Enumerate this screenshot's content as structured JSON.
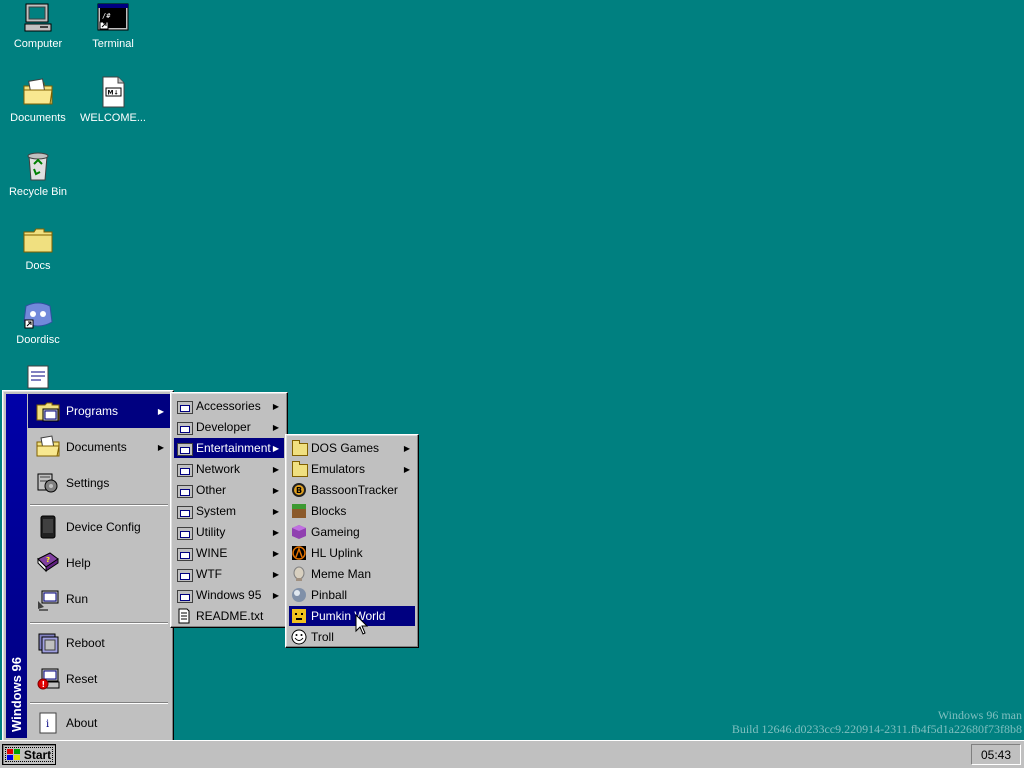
{
  "desktop": {
    "icons": [
      {
        "label": "Computer",
        "icon": "computer-icon"
      },
      {
        "label": "Terminal",
        "icon": "terminal-icon"
      },
      {
        "label": "Documents",
        "icon": "documents-folder-icon"
      },
      {
        "label": "WELCOME...",
        "icon": "markdown-file-icon"
      },
      {
        "label": "Recycle Bin",
        "icon": "recycle-bin-icon"
      },
      {
        "label": "Docs",
        "icon": "folder-icon"
      },
      {
        "label": "Doordisc",
        "icon": "doordisc-icon"
      }
    ],
    "watermark": {
      "line1": "Windows 96 man",
      "line2": "Build 12646.d0233cc9.220914-2311.fb4f5d1a22680f73f8b8"
    }
  },
  "start_menu": {
    "banner": "Windows 96",
    "items": [
      {
        "label": "Programs",
        "icon": "programs-icon",
        "has_submenu": true
      },
      {
        "label": "Documents",
        "icon": "documents-icon",
        "has_submenu": true
      },
      {
        "label": "Settings",
        "icon": "settings-icon",
        "has_submenu": false
      },
      {
        "label": "Device Config",
        "icon": "device-config-icon",
        "has_submenu": false
      },
      {
        "label": "Help",
        "icon": "help-book-icon",
        "has_submenu": false
      },
      {
        "label": "Run",
        "icon": "run-icon",
        "has_submenu": false
      },
      {
        "label": "Reboot",
        "icon": "reboot-icon",
        "has_submenu": false
      },
      {
        "label": "Reset",
        "icon": "reset-icon",
        "has_submenu": false
      },
      {
        "label": "About",
        "icon": "about-icon",
        "has_submenu": false
      }
    ]
  },
  "programs_menu": {
    "items": [
      {
        "label": "Accessories"
      },
      {
        "label": "Developer"
      },
      {
        "label": "Entertainment"
      },
      {
        "label": "Network"
      },
      {
        "label": "Other"
      },
      {
        "label": "System"
      },
      {
        "label": "Utility"
      },
      {
        "label": "WINE"
      },
      {
        "label": "WTF"
      },
      {
        "label": "Windows 95"
      },
      {
        "label": "README.txt"
      }
    ]
  },
  "entertainment_menu": {
    "items": [
      {
        "label": "DOS Games"
      },
      {
        "label": "Emulators"
      },
      {
        "label": "BassoonTracker"
      },
      {
        "label": "Blocks"
      },
      {
        "label": "Gameing"
      },
      {
        "label": "HL Uplink"
      },
      {
        "label": "Meme Man"
      },
      {
        "label": "Pinball"
      },
      {
        "label": "Pumkin World"
      },
      {
        "label": "Troll"
      }
    ]
  },
  "taskbar": {
    "start_label": "Start",
    "clock": "05:43"
  },
  "colors": {
    "desktop": "#008080",
    "selection": "#000080",
    "face": "#c0c0c0"
  }
}
